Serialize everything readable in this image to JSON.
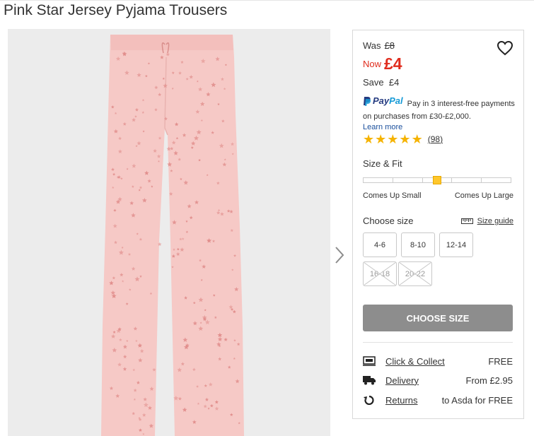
{
  "product": {
    "title": "Pink Star Jersey Pyjama Trousers"
  },
  "pricing": {
    "was_label": "Was",
    "was_price": "£8",
    "now_label": "Now",
    "now_price": "£4",
    "save_label": "Save",
    "save_amount": "£4"
  },
  "paypal": {
    "brand_pay": "Pay",
    "brand_pal": "Pal",
    "message": "Pay in 3 interest-free payments on purchases from £30-£2,000.",
    "learn_more": "Learn more"
  },
  "rating": {
    "stars": 5,
    "count": "98"
  },
  "size_fit": {
    "title": "Size & Fit",
    "min_label": "Comes Up Small",
    "max_label": "Comes Up Large",
    "level": 0.5
  },
  "sizes": {
    "title": "Choose size",
    "guide_label": "Size guide",
    "options": [
      {
        "label": "4-6",
        "available": true
      },
      {
        "label": "8-10",
        "available": true
      },
      {
        "label": "12-14",
        "available": true
      },
      {
        "label": "16-18",
        "available": false
      },
      {
        "label": "20-22",
        "available": false
      }
    ]
  },
  "cta": {
    "label": "CHOOSE SIZE"
  },
  "delivery": [
    {
      "icon": "click-collect-icon",
      "link": "Click & Collect",
      "info": "FREE"
    },
    {
      "icon": "delivery-truck-icon",
      "link": "Delivery",
      "info": "From £2.95"
    },
    {
      "icon": "returns-icon",
      "link": "Returns",
      "info": "to Asda for FREE"
    }
  ],
  "colors": {
    "now_price": "#e02c1d",
    "star": "#f5b300",
    "fit_marker": "#ffc72c",
    "cta_bg": "#8d8d8d",
    "trousers": "#f6c9c6",
    "star_print": "#e08c8a"
  }
}
